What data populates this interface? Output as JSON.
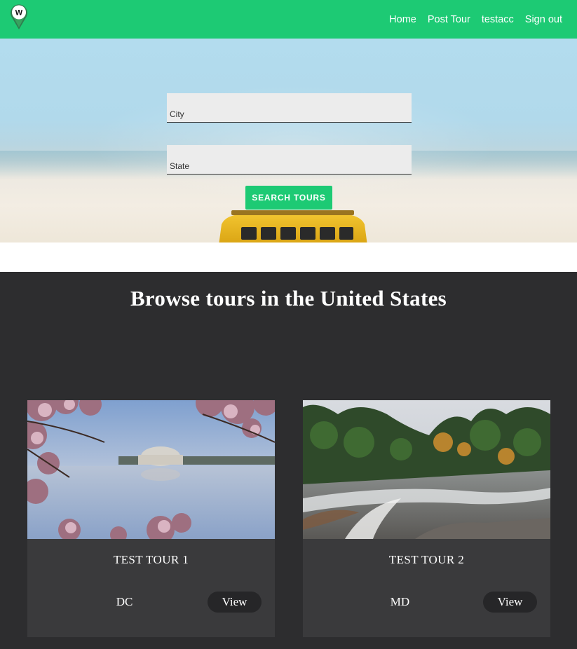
{
  "navbar": {
    "logo_letter": "W",
    "links": [
      "Home",
      "Post Tour",
      "testacc",
      "Sign out"
    ]
  },
  "search": {
    "city_placeholder": "City",
    "state_placeholder": "State",
    "button_label": "SEARCH TOURS"
  },
  "browse": {
    "title": "Browse tours in the United States",
    "tours": [
      {
        "title": "TEST TOUR 1",
        "state": "DC",
        "view_label": "View"
      },
      {
        "title": "TEST TOUR 2",
        "state": "MD",
        "view_label": "View"
      }
    ]
  },
  "colors": {
    "brand_green": "#1dca74",
    "section_bg": "#2d2d2f",
    "card_bg": "#3a3a3c"
  }
}
